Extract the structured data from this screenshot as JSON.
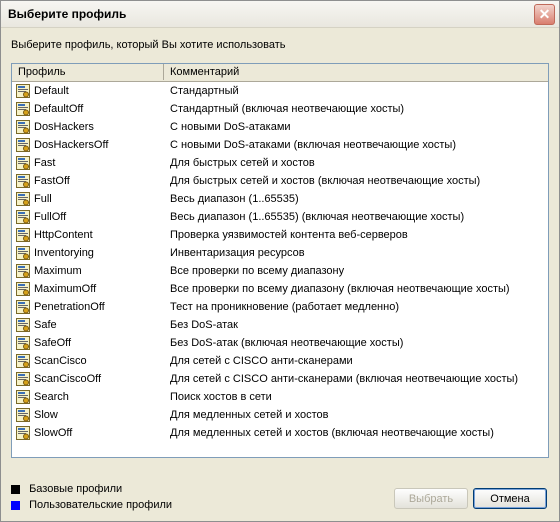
{
  "window": {
    "title": "Выберите профиль",
    "close_glyph": "✕"
  },
  "prompt": "Выберите профиль, который Вы хотите использовать",
  "columns": {
    "profile": "Профиль",
    "comment": "Комментарий"
  },
  "profiles": [
    {
      "name": "Default",
      "comment": "Стандартный"
    },
    {
      "name": "DefaultOff",
      "comment": "Стандартный (включая неотвечающие хосты)"
    },
    {
      "name": "DosHackers",
      "comment": "С новыми DoS-атаками"
    },
    {
      "name": "DosHackersOff",
      "comment": "С новыми DoS-атаками (включая неотвечающие хосты)"
    },
    {
      "name": "Fast",
      "comment": "Для быстрых сетей и хостов"
    },
    {
      "name": "FastOff",
      "comment": "Для быстрых сетей и хостов (включая неотвечающие хосты)"
    },
    {
      "name": "Full",
      "comment": "Весь диапазон (1..65535)"
    },
    {
      "name": "FullOff",
      "comment": "Весь диапазон (1..65535) (включая неотвечающие хосты)"
    },
    {
      "name": "HttpContent",
      "comment": "Проверка уязвимостей контента веб-серверов"
    },
    {
      "name": "Inventorying",
      "comment": "Инвентаризация ресурсов"
    },
    {
      "name": "Maximum",
      "comment": "Все проверки по всему диапазону"
    },
    {
      "name": "MaximumOff",
      "comment": "Все проверки по всему диапазону (включая неотвечающие хосты)"
    },
    {
      "name": "PenetrationOff",
      "comment": "Тест на проникновение (работает медленно)"
    },
    {
      "name": "Safe",
      "comment": "Без DoS-атак"
    },
    {
      "name": "SafeOff",
      "comment": "Без DoS-атак (включая неотвечающие хосты)"
    },
    {
      "name": "ScanCisco",
      "comment": "Для сетей с CISCO анти-сканерами"
    },
    {
      "name": "ScanCiscoOff",
      "comment": "Для сетей с CISCO анти-сканерами (включая неотвечающие хосты)"
    },
    {
      "name": "Search",
      "comment": "Поиск хостов в сети"
    },
    {
      "name": "Slow",
      "comment": "Для медленных сетей и хостов"
    },
    {
      "name": "SlowOff",
      "comment": "Для медленных сетей и хостов (включая неотвечающие хосты)"
    }
  ],
  "legend": {
    "base": {
      "label": "Базовые профили",
      "color": "#000000"
    },
    "user": {
      "label": "Пользовательские профили",
      "color": "#0000ff"
    }
  },
  "buttons": {
    "select": "Выбрать",
    "cancel": "Отмена"
  },
  "icon": {
    "name": "profile-icon"
  }
}
